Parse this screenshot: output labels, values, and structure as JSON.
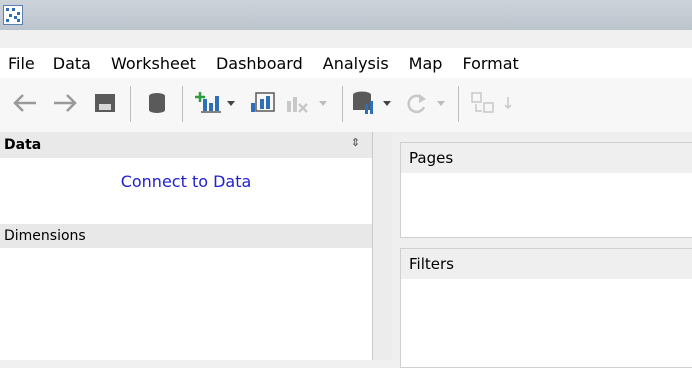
{
  "menu": {
    "items": [
      "File",
      "Data",
      "Worksheet",
      "Dashboard",
      "Analysis",
      "Map",
      "Format"
    ]
  },
  "icons": {
    "toolbar": [
      "back-arrow-icon",
      "forward-arrow-icon",
      "save-icon",
      "database-icon",
      "new-worksheet-icon",
      "new-dashboard-icon",
      "clear-sheet-icon",
      "data-source-icon",
      "refresh-icon",
      "swap-icon"
    ]
  },
  "left_pane": {
    "title": "Data",
    "connect_label": "Connect to Data",
    "dimensions_label": "Dimensions"
  },
  "right_pane": {
    "pages_label": "Pages",
    "filters_label": "Filters"
  },
  "colors": {
    "link_blue": "#2121cf",
    "icon_gray": "#6a6a6a",
    "icon_blue": "#2e6fb8",
    "icon_green": "#2e9b3d"
  }
}
